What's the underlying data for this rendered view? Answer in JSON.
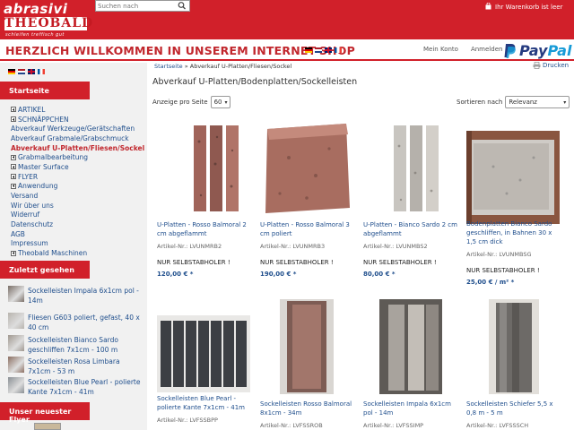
{
  "header": {
    "logo_brand": "abrasivi",
    "logo_name": "THEOBALD",
    "logo_tagline": "schleifen   treffisch   gut",
    "search_placeholder": "Suchen nach",
    "cart_text": "Ihr Warenkorb ist leer"
  },
  "banner": {
    "welcome": "HERZLICH WILLKOMMEN IN UNSEREM INTERNET-SHOP",
    "my_account": "Mein Konto",
    "login": "Anmelden",
    "paypal_pay": "Pay",
    "paypal_pal": "Pal"
  },
  "sidebar": {
    "start_heading": "Startseite",
    "nav": [
      {
        "label": "ARTIKEL",
        "expand": true
      },
      {
        "label": "SCHNÄPPCHEN",
        "expand": true
      },
      {
        "label": "Abverkauf Werkzeuge/Gerätschaften",
        "expand": false
      },
      {
        "label": "Abverkauf Grabmale/Grabschmuck",
        "expand": false
      },
      {
        "label": "Abverkauf U-Platten/Fliesen/Sockel",
        "expand": false,
        "active": true
      },
      {
        "label": "Grabmalbearbeitung",
        "expand": true
      },
      {
        "label": "Master Surface",
        "expand": true
      },
      {
        "label": "FLYER",
        "expand": true
      },
      {
        "label": "Anwendung",
        "expand": true
      },
      {
        "label": "Versand",
        "expand": false
      },
      {
        "label": "Wir über uns",
        "expand": false
      },
      {
        "label": "Widerruf",
        "expand": false
      },
      {
        "label": "Datenschutz",
        "expand": false
      },
      {
        "label": "AGB",
        "expand": false
      },
      {
        "label": "Impressum",
        "expand": false
      },
      {
        "label": "Theobald Maschinen",
        "expand": true
      }
    ],
    "recent_heading": "Zuletzt gesehen",
    "recent": [
      {
        "text": "Sockelleisten Impala 6x1cm pol - 14m"
      },
      {
        "text": "Fliesen G603 poliert, gefast, 40 x 40 cm"
      },
      {
        "text": "Sockelleisten Bianco Sardo geschliffen 7x1cm - 100 m"
      },
      {
        "text": "Sockelleisten Rosa Limbara 7x1cm - 53 m"
      },
      {
        "text": "Sockelleisten Blue Pearl - polierte Kante 7x1cm - 41m"
      }
    ],
    "flyer_heading": "Unser neuester Flyer"
  },
  "main": {
    "breadcrumb_home": "Startseite",
    "breadcrumb_sep": "»",
    "breadcrumb_current": "Abverkauf U-Platten/Fliesen/Sockel",
    "print": "Drucken",
    "category_title": "Abverkauf U-Platten/Bodenplatten/Sockelleisten",
    "per_page_label": "Anzeige pro Seite",
    "per_page_value": "60",
    "sort_label": "Sortieren nach",
    "sort_value": "Relevanz",
    "products": [
      {
        "name": "U-Platten - Rosso Balmoral 2 cm abgeflammt",
        "art": "Artikel-Nr.: LVUNMRB2",
        "pickup": "NUR SELBSTABHOLER !",
        "price": "120,00 € *"
      },
      {
        "name": "U-Platten - Rosso Balmoral 3 cm poliert",
        "art": "Artikel-Nr.: LVUNMRB3",
        "pickup": "NUR SELBSTABHOLER !",
        "price": "190,00 € *"
      },
      {
        "name": "U-Platten - Bianco Sardo 2 cm abgeflammt",
        "art": "Artikel-Nr.: LVUNMBS2",
        "pickup": "NUR SELBSTABHOLER !",
        "price": "80,00 € *"
      },
      {
        "name": "Bodenplatten Bianco Sardo geschliffen, in Bahnen 30 x 1,5 cm dick",
        "art": "Artikel-Nr.: LVUNMBSG",
        "pickup": "NUR SELBSTABHOLER !",
        "price": "25,00 € / m² *"
      },
      {
        "name": "Sockelleisten Blue Pearl - polierte Kante 7x1cm - 41m",
        "art": "Artikel-Nr.: LVFSSBPP"
      },
      {
        "name": "Sockelleisten Rosso Balmoral 8x1cm - 34m",
        "art": "Artikel-Nr.: LVFSSROB"
      },
      {
        "name": "Sockelleisten Impala 6x1cm pol - 14m",
        "art": "Artikel-Nr.: LVFSSIMP"
      },
      {
        "name": "Sockelleisten Schiefer 5,5 x 0,8 m - 5 m",
        "art": "Artikel-Nr.: LVFSSSCH"
      }
    ]
  },
  "colors": {
    "brand_red": "#d1202a",
    "link_blue": "#1f4e8c",
    "title_red": "#c1272d"
  }
}
